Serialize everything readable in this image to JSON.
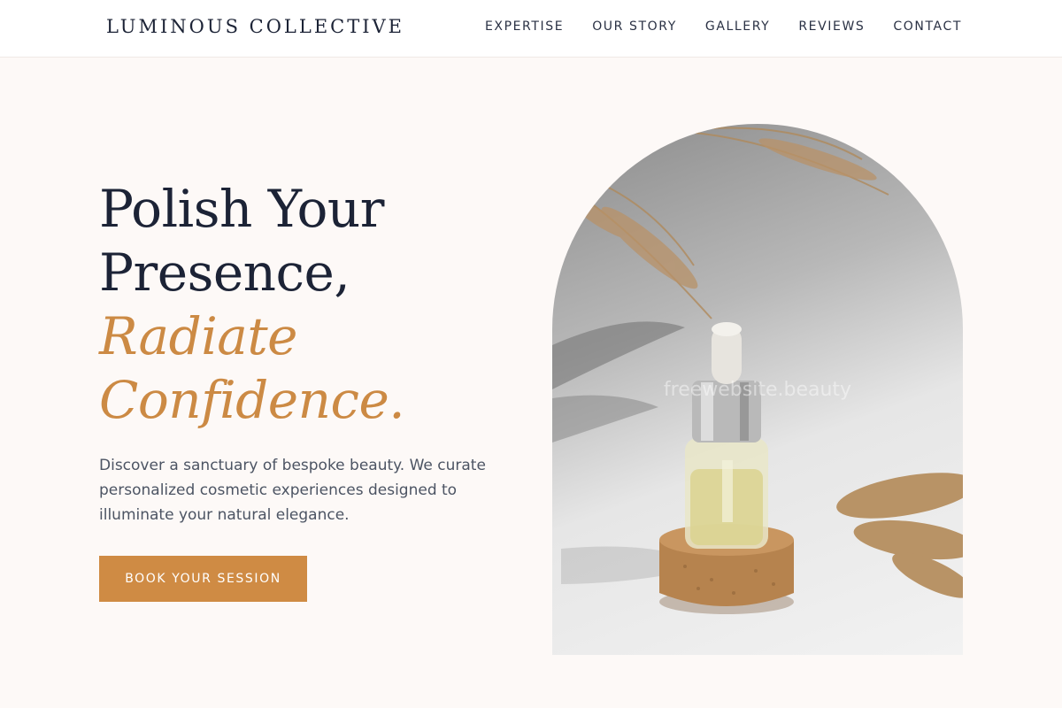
{
  "header": {
    "brand": "LUMINOUS COLLECTIVE",
    "nav": [
      {
        "label": "EXPERTISE"
      },
      {
        "label": "OUR STORY"
      },
      {
        "label": "GALLERY"
      },
      {
        "label": "REVIEWS"
      },
      {
        "label": "CONTACT"
      }
    ]
  },
  "hero": {
    "headline": {
      "line1": "Polish Your",
      "line2": "Presence,",
      "accent1": "Radiate",
      "accent2": "Confidence."
    },
    "intro": "Discover a sanctuary of bespoke beauty. We curate personalized cosmetic experiences designed to illuminate your natural elegance.",
    "cta_label": "BOOK YOUR SESSION",
    "image": {
      "watermark": "freewebsite.beauty",
      "subject": "serum dropper bottle on cork stand with dried pampas grass"
    }
  },
  "colors": {
    "background": "#fdf9f7",
    "navy": "#1c2336",
    "accent": "#cc8a44",
    "cta": "#cf8b44",
    "body_text": "#4c5463"
  }
}
